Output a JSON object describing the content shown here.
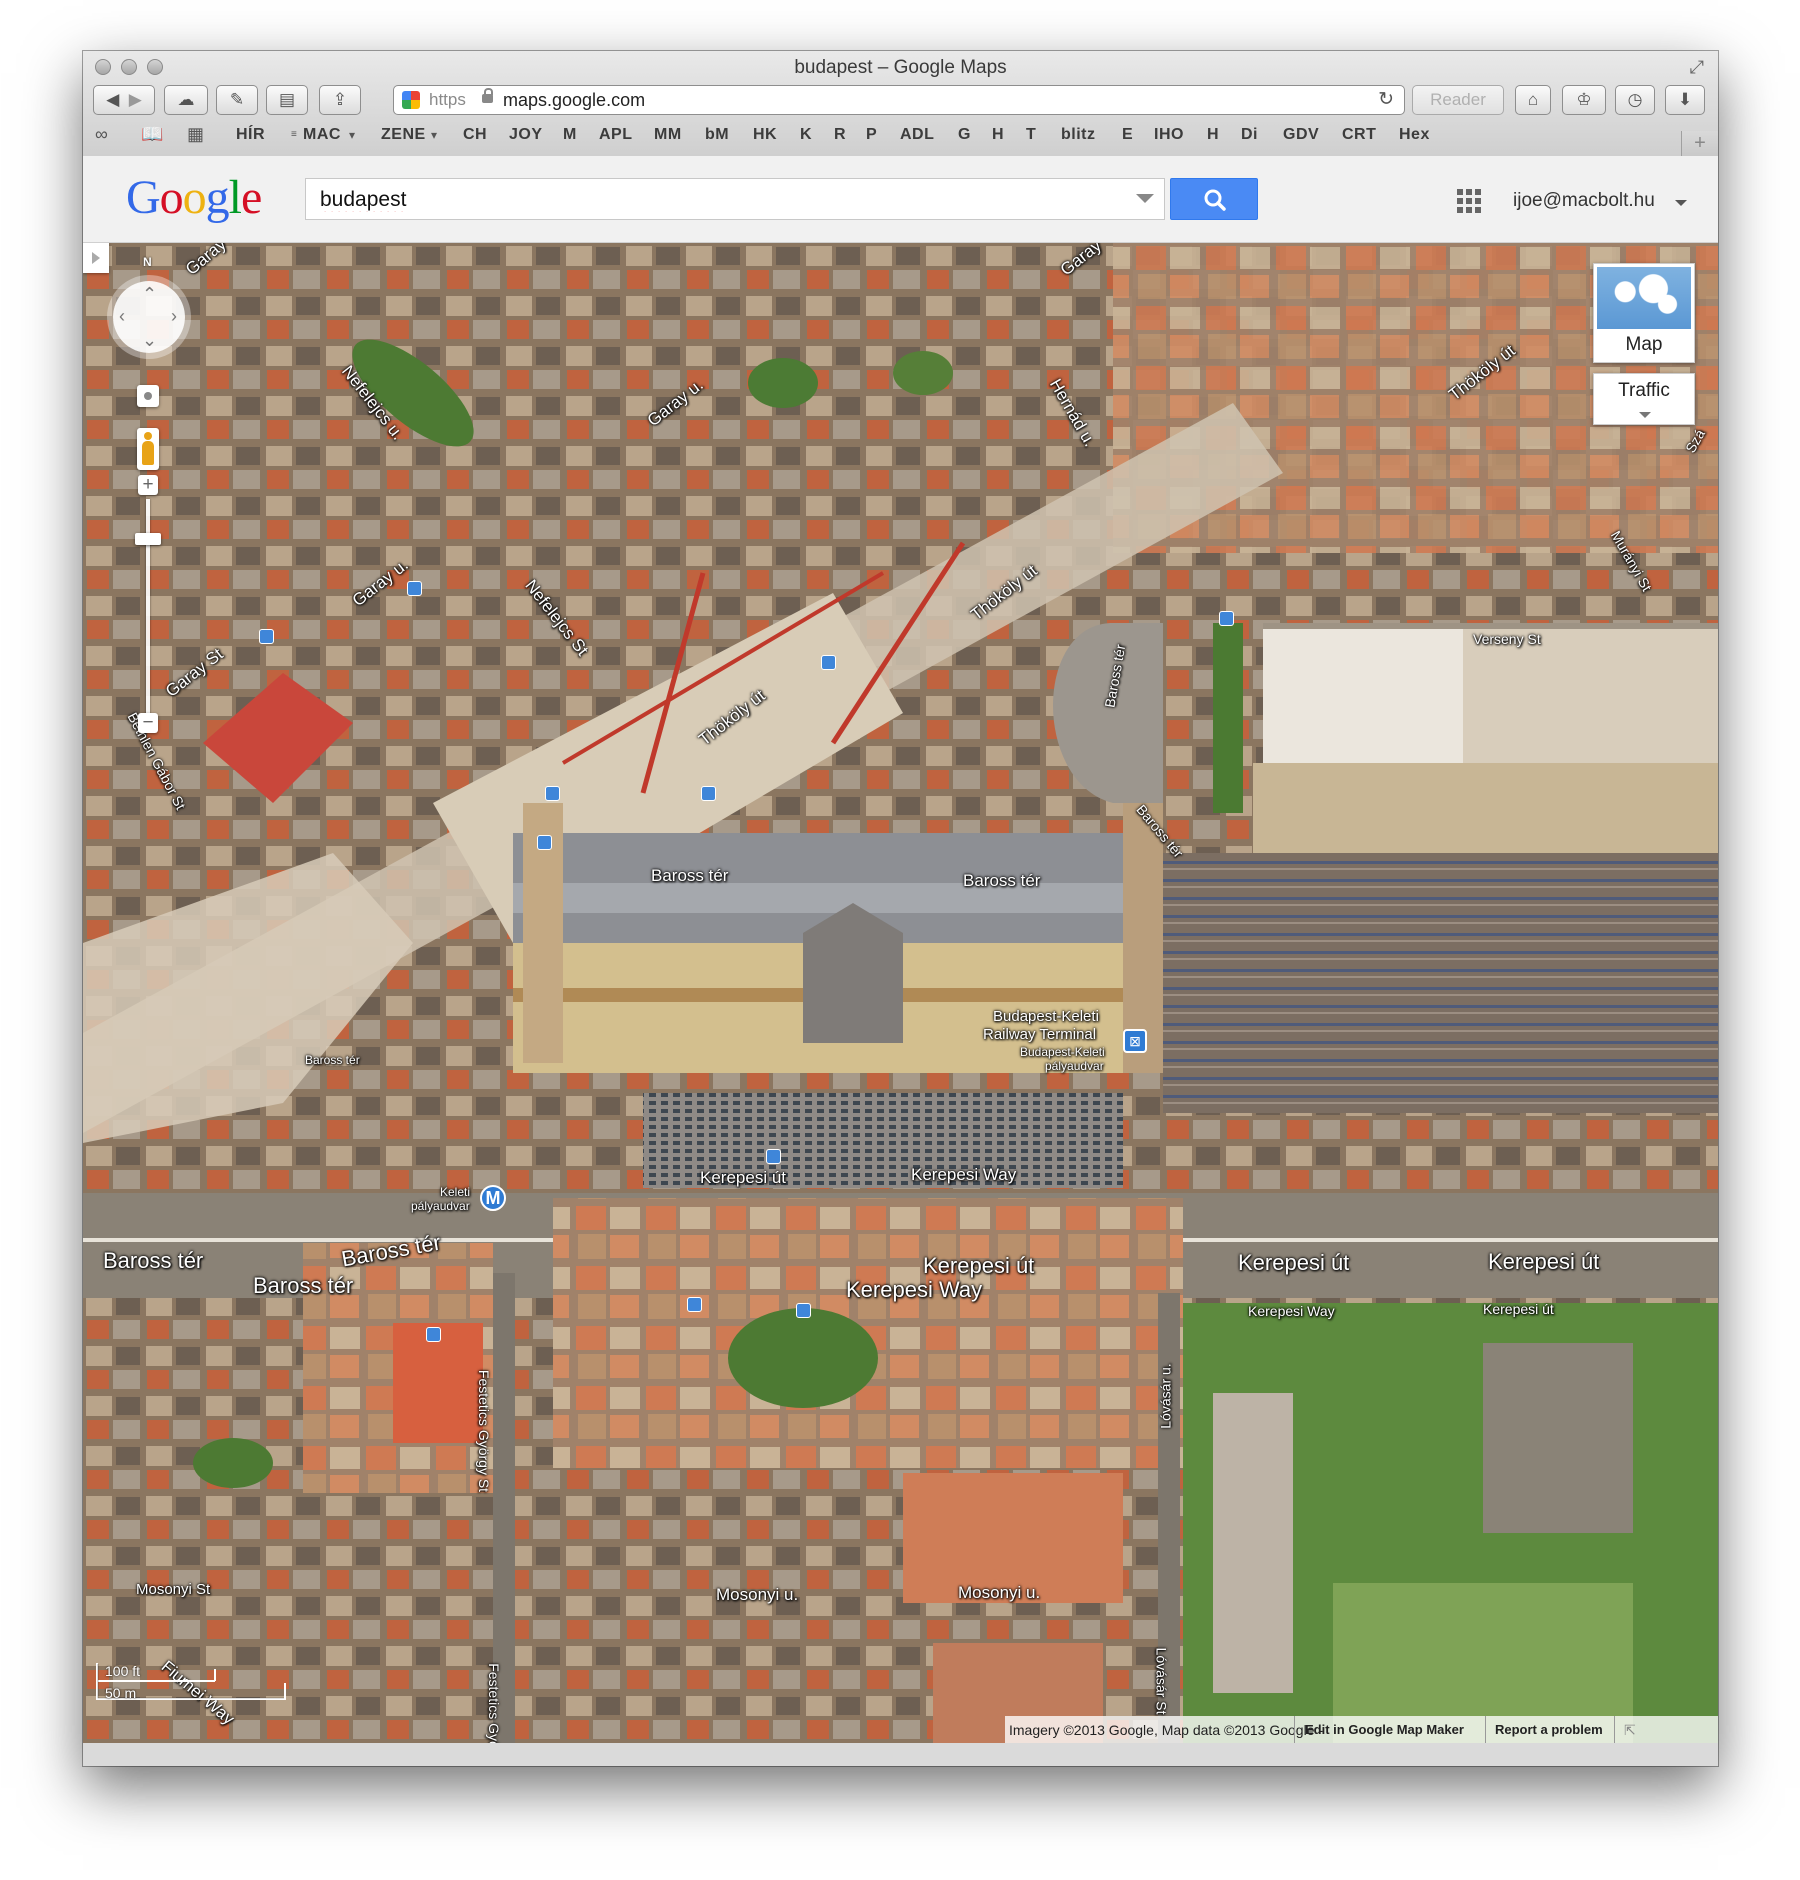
{
  "window": {
    "title": "budapest – Google Maps"
  },
  "toolbar": {
    "back_icon": "back-arrow-icon",
    "forward_icon": "forward-arrow-icon",
    "url_scheme": "https",
    "url_host": "maps.google.com",
    "reader_label": "Reader"
  },
  "bookmarks": [
    "HÍR",
    "MAC",
    "ZENE",
    "CH",
    "JOY",
    "M",
    "APL",
    "MM",
    "bM",
    "HK",
    "K",
    "R",
    "P",
    "ADL",
    "G",
    "H",
    "T",
    "blitz",
    "E",
    "IHO",
    "H",
    "Di",
    "GDV",
    "CRT",
    "Hex"
  ],
  "google": {
    "logo": "Google",
    "search_value": "budapest",
    "account": "ijoe@macbolt.hu",
    "colors": {
      "search_button": "#4a8af4"
    }
  },
  "map": {
    "north": "N",
    "maptype_label": "Map",
    "traffic_label": "Traffic",
    "scale_ft": "100 ft",
    "scale_m": "50 m",
    "metro_letter": "M",
    "labels": {
      "garay1": "Garay u.",
      "garay2": "Garay u.",
      "garay_st": "Garay St",
      "garay_top": "Garay",
      "nefelejcs1": "Nefelejcs u.",
      "nefelejcs2": "Nefelejcs St",
      "hernad": "Hernád u.",
      "thokoly1": "Thököly út",
      "thokoly2": "Thököly út",
      "thokoly3": "Thököly út",
      "verseny": "Verseny St",
      "murany": "Murányi St",
      "bethlen": "Bethlen Gábor St",
      "baross_ter1": "Baross tér",
      "baross_ter2": "Baross tér",
      "baross_ter3": "Baross tér",
      "baross_ter4": "Baross tér",
      "baross_ter5": "Baross tér",
      "baross_ter6": "Baross tér",
      "baross_ter_small": "Baross tér",
      "baross_vert": "Baross tér",
      "baross_diag": "Baross tér",
      "keleti1": "Budapest-Keleti",
      "keleti2": "Railway Terminal",
      "keleti3": "Budapest-Keleti",
      "keleti4": "pályaudvar",
      "keleti_metro1": "Keleti",
      "keleti_metro2": "pályaudvar",
      "kerepesi1": "Kerepesi út",
      "kerepesi_way1": "Kerepesi Way",
      "kerepesi2": "Kerepesi út",
      "kerepesi_way2": "Kerepesi Way",
      "kerepesi3": "Kerepesi út",
      "kerepesi4": "Kerepesi út",
      "kerepesi_way3": "Kerepesi Way",
      "kerepesi5": "Kerepesi út",
      "festetics1": "Festetics György St",
      "festetics2": "Festetics Gyö",
      "lovasar1": "Lóvásár u.",
      "lovasar2": "Lóvásár St",
      "mosonyi1": "Mosonyi St",
      "mosonyi2": "Mosonyi u.",
      "mosonyi3": "Mosonyi u.",
      "fiumei": "Fiumei Way",
      "sza": "Szá"
    },
    "footer": {
      "attribution": "Imagery ©2013 Google, Map data ©2013 Google -",
      "edit": "Edit in Google Map Maker",
      "report": "Report a problem"
    }
  }
}
